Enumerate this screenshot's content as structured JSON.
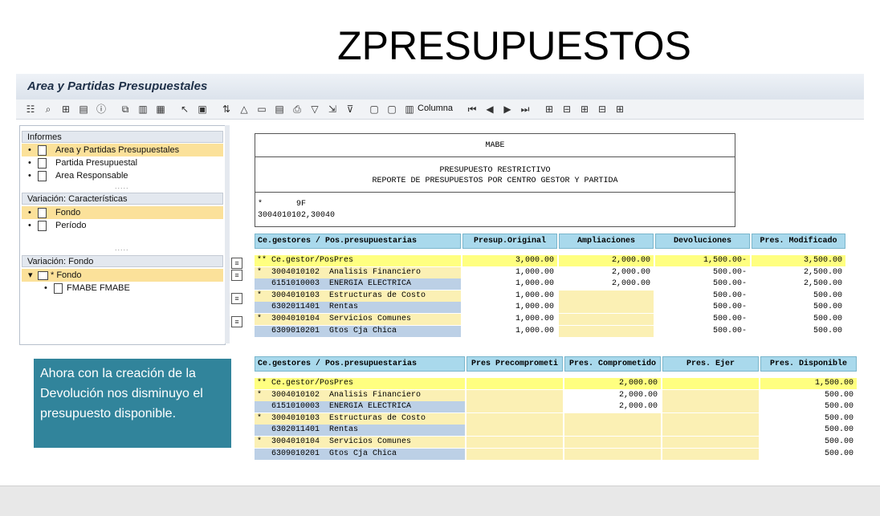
{
  "slide": {
    "title": "ZPRESUPUESTOS"
  },
  "window": {
    "title": "Area y Partidas Presupuestales"
  },
  "toolbar": {
    "columna_label": "Columna"
  },
  "tree": {
    "sections": [
      {
        "label": "Informes",
        "items": [
          {
            "label": "Area y Partidas Presupuestales",
            "selected": true
          },
          {
            "label": "Partida Presupuestal",
            "selected": false
          },
          {
            "label": "Area Responsable",
            "selected": false
          }
        ]
      },
      {
        "label": "Variación: Características",
        "items": [
          {
            "label": "Fondo",
            "selected": true
          },
          {
            "label": "Período",
            "selected": false
          }
        ]
      },
      {
        "label": "Variación: Fondo",
        "items": [
          {
            "label": "* Fondo",
            "selected": true
          },
          {
            "label": "FMABE FMABE",
            "selected": false
          }
        ]
      }
    ],
    "dots": "....."
  },
  "report": {
    "company": "MABE",
    "line1": "PRESUPUESTO RESTRICTIVO",
    "line2": "REPORTE DE PRESUPUESTOS POR CENTRO GESTOR Y PARTIDA",
    "filter1": "*       9F",
    "filter2": "3004010102,30040",
    "table1": {
      "headers": [
        "Ce.gestores / Pos.presupuestarias",
        "Presup.Original",
        "Ampliaciones",
        "Devoluciones",
        "Pres. Modificado"
      ],
      "rows": [
        {
          "label": "** Ce.gestor/PosPres",
          "values": [
            "3,000.00",
            "2,000.00",
            "1,500.00-",
            "3,500.00"
          ],
          "style": "y"
        },
        {
          "label": "*  3004010102  Analisis Financiero",
          "values": [
            "1,000.00",
            "2,000.00",
            "500.00-",
            "2,500.00"
          ],
          "style": "l"
        },
        {
          "label": "   6151010003  ENERGIA ELECTRICA",
          "values": [
            "1,000.00",
            "2,000.00",
            "500.00-",
            "2,500.00"
          ],
          "style": "b"
        },
        {
          "label": "*  3004010103  Estructuras de Costo",
          "values": [
            "1,000.00",
            "",
            "500.00-",
            "500.00"
          ],
          "style": "l"
        },
        {
          "label": "   6302011401  Rentas",
          "values": [
            "1,000.00",
            "",
            "500.00-",
            "500.00"
          ],
          "style": "b"
        },
        {
          "label": "*  3004010104  Servicios Comunes",
          "values": [
            "1,000.00",
            "",
            "500.00-",
            "500.00"
          ],
          "style": "l"
        },
        {
          "label": "   6309010201  Gtos Cja Chica",
          "values": [
            "1,000.00",
            "",
            "500.00-",
            "500.00"
          ],
          "style": "b"
        }
      ]
    },
    "table2": {
      "headers": [
        "Ce.gestores / Pos.presupuestarias",
        "Pres Precomprometi",
        "Pres. Comprometido",
        "Pres. Ejer",
        "Pres. Disponible"
      ],
      "rows": [
        {
          "label": "** Ce.gestor/PosPres",
          "values": [
            "",
            "2,000.00",
            "",
            "1,500.00"
          ],
          "style": "y"
        },
        {
          "label": "*  3004010102  Analisis Financiero",
          "values": [
            "",
            "2,000.00",
            "",
            "500.00"
          ],
          "style": "l"
        },
        {
          "label": "   6151010003  ENERGIA ELECTRICA",
          "values": [
            "",
            "2,000.00",
            "",
            "500.00"
          ],
          "style": "b"
        },
        {
          "label": "*  3004010103  Estructuras de Costo",
          "values": [
            "",
            "",
            "",
            "500.00"
          ],
          "style": "l"
        },
        {
          "label": "   6302011401  Rentas",
          "values": [
            "",
            "",
            "",
            "500.00"
          ],
          "style": "b"
        },
        {
          "label": "*  3004010104  Servicios Comunes",
          "values": [
            "",
            "",
            "",
            "500.00"
          ],
          "style": "l"
        },
        {
          "label": "   6309010201  Gtos Cja Chica",
          "values": [
            "",
            "",
            "",
            "500.00"
          ],
          "style": "b"
        }
      ]
    }
  },
  "callout": {
    "text": "Ahora con la creación de la Devolución nos disminuyo el presupuesto  disponible."
  },
  "colors": {
    "callout_bg": "#31849b",
    "header_blue": "#a9d9ec",
    "highlight_yellow": "#ffff80",
    "selection": "#fbe19a"
  }
}
